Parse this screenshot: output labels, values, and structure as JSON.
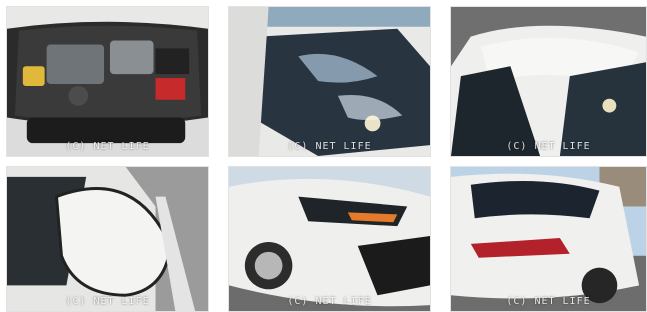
{
  "gallery": {
    "photos": [
      {
        "subject": "engine-bay",
        "watermark": "(C) NET LIFE"
      },
      {
        "subject": "windshield",
        "watermark": "(C) NET LIFE"
      },
      {
        "subject": "roof-rear-window",
        "watermark": "(C) NET LIFE"
      },
      {
        "subject": "side-mirror",
        "watermark": "(C) NET LIFE"
      },
      {
        "subject": "front-bumper-headlight",
        "watermark": "(C) NET LIFE"
      },
      {
        "subject": "rear-taillight",
        "watermark": "(C) NET LIFE"
      }
    ]
  },
  "colors": {
    "car_body": "#f2f2f0",
    "glass": "#1f2a33",
    "sky": "#bcd2e6",
    "asphalt": "#6c6c6c",
    "taillight": "#b3222a"
  }
}
